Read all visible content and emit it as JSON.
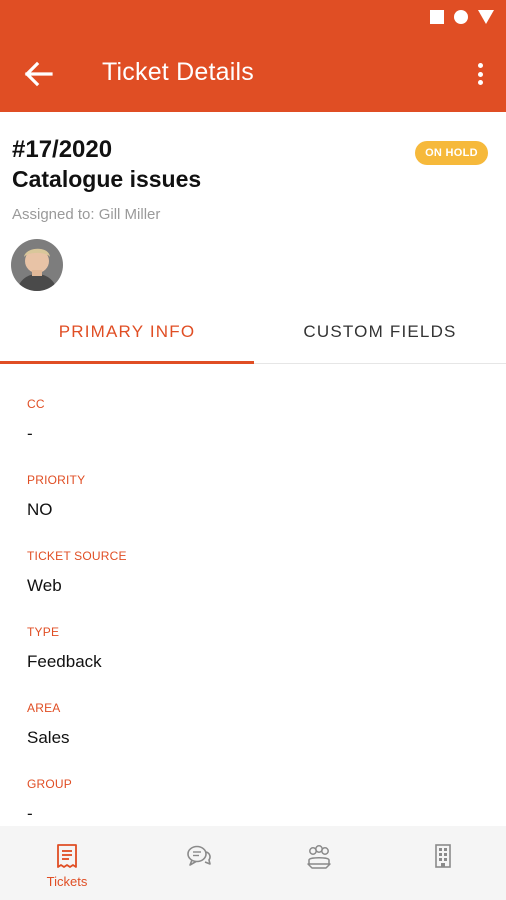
{
  "header": {
    "title": "Ticket Details",
    "back_icon": "arrow-left-icon",
    "more_icon": "more-vert-icon",
    "background": "#e04e24"
  },
  "ticket": {
    "number": "#17/2020",
    "subject": "Catalogue issues",
    "assigned": "Assigned to: Gill Miller",
    "status": "ON HOLD",
    "status_color": "#f6b93b"
  },
  "tabs": [
    {
      "label": "PRIMARY INFO",
      "active": true
    },
    {
      "label": "CUSTOM FIELDS",
      "active": false
    }
  ],
  "fields": [
    {
      "label": "CC",
      "value": "-"
    },
    {
      "label": "PRIORITY",
      "value": "NO"
    },
    {
      "label": "TICKET SOURCE",
      "value": "Web"
    },
    {
      "label": "TYPE",
      "value": "Feedback"
    },
    {
      "label": "AREA",
      "value": "Sales"
    },
    {
      "label": "GROUP",
      "value": "-"
    }
  ],
  "bottom_nav": [
    {
      "label": "Tickets",
      "icon": "ticket-icon",
      "active": true
    },
    {
      "label": "",
      "icon": "chat-icon",
      "active": false
    },
    {
      "label": "",
      "icon": "people-icon",
      "active": false
    },
    {
      "label": "",
      "icon": "building-icon",
      "active": false
    }
  ],
  "accent": "#e04e24"
}
